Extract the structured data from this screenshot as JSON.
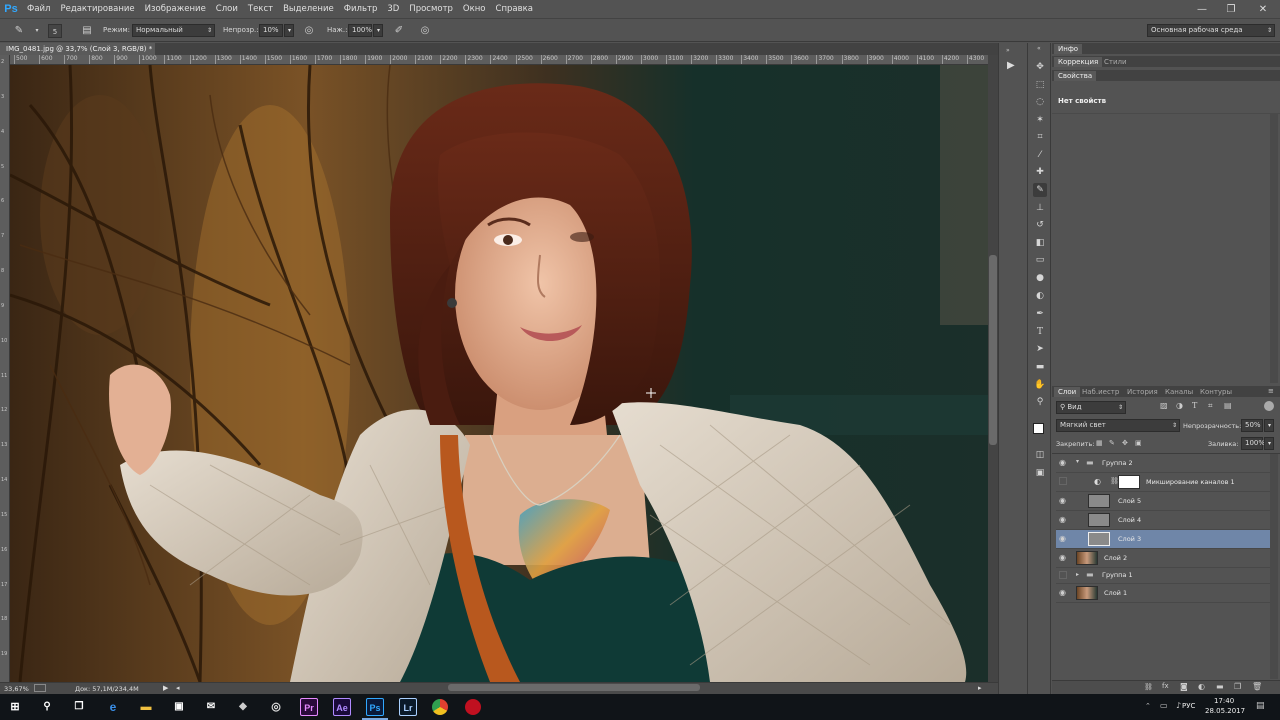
{
  "app": {
    "logo": "Ps",
    "menu": [
      "Файл",
      "Редактирование",
      "Изображение",
      "Слои",
      "Текст",
      "Выделение",
      "Фильтр",
      "3D",
      "Просмотр",
      "Окно",
      "Справка"
    ],
    "window_controls": [
      "—",
      "❐",
      "✕"
    ]
  },
  "options": {
    "mode_label": "Режим:",
    "mode_value": "Нормальный",
    "opacity_label": "Непрозр.:",
    "opacity_value": "10%",
    "flow_label": "Наж.:",
    "flow_value": "100%",
    "workspace": "Основная рабочая среда",
    "brush_size": "5"
  },
  "document": {
    "tab_title": "IMG_0481.jpg @ 33,7% (Слой 3, RGB/8) *",
    "zoom": "33,67%",
    "doc_info": "Док: 57,1M/234,4M",
    "ruler_h": [
      "500",
      "600",
      "700",
      "800",
      "900",
      "1000",
      "1100",
      "1200",
      "1300",
      "1400",
      "1500",
      "1600",
      "1700",
      "1800",
      "1900",
      "2000",
      "2100",
      "2200",
      "2300",
      "2400",
      "2500",
      "2600",
      "2700",
      "2800",
      "2900",
      "3000",
      "3100",
      "3200",
      "3300",
      "3400",
      "3500",
      "3600",
      "3700",
      "3800",
      "3900",
      "4000",
      "4100",
      "4200",
      "4300"
    ],
    "ruler_v": [
      "2",
      "3",
      "4",
      "5",
      "6",
      "7",
      "8",
      "9",
      "10",
      "11",
      "12",
      "13",
      "14",
      "15",
      "16",
      "17",
      "18",
      "19"
    ]
  },
  "panels": {
    "top_tabs": [
      "Инфо"
    ],
    "adj_tabs": [
      "Коррекция",
      "Стили"
    ],
    "props_tab": "Свойства",
    "props_text": "Нет свойств",
    "layer_tabs": [
      "Слои",
      "Наб.иестр",
      "История",
      "Каналы",
      "Контуры"
    ],
    "kind_filter": "Вид",
    "blend_mode": "Мягкий свет",
    "opacity_label": "Непрозрачность:",
    "opacity_value": "50%",
    "lock_label": "Закрепить:",
    "fill_label": "Заливка:",
    "fill_value": "100%"
  },
  "layers": [
    {
      "name": "Группа 2",
      "type": "group-open",
      "visible": true
    },
    {
      "name": "Микширование каналов 1",
      "type": "adjustment",
      "visible": false
    },
    {
      "name": "Слой 5",
      "type": "gray",
      "visible": true
    },
    {
      "name": "Слой 4",
      "type": "gray",
      "visible": true
    },
    {
      "name": "Слой 3",
      "type": "gray",
      "visible": true,
      "selected": true
    },
    {
      "name": "Слой 2",
      "type": "photo",
      "visible": true
    },
    {
      "name": "Группа 1",
      "type": "group-closed",
      "visible": false
    },
    {
      "name": "Слой 1",
      "type": "photo",
      "visible": true
    }
  ],
  "taskbar": {
    "lang": "РУС",
    "time": "17:40",
    "date": "28.05.2017",
    "apps": [
      "Pr",
      "Ae",
      "Ps",
      "Lr"
    ]
  },
  "colors": {
    "accent": "#31a8ff",
    "selection": "#6f86a8",
    "panel": "#535353"
  }
}
